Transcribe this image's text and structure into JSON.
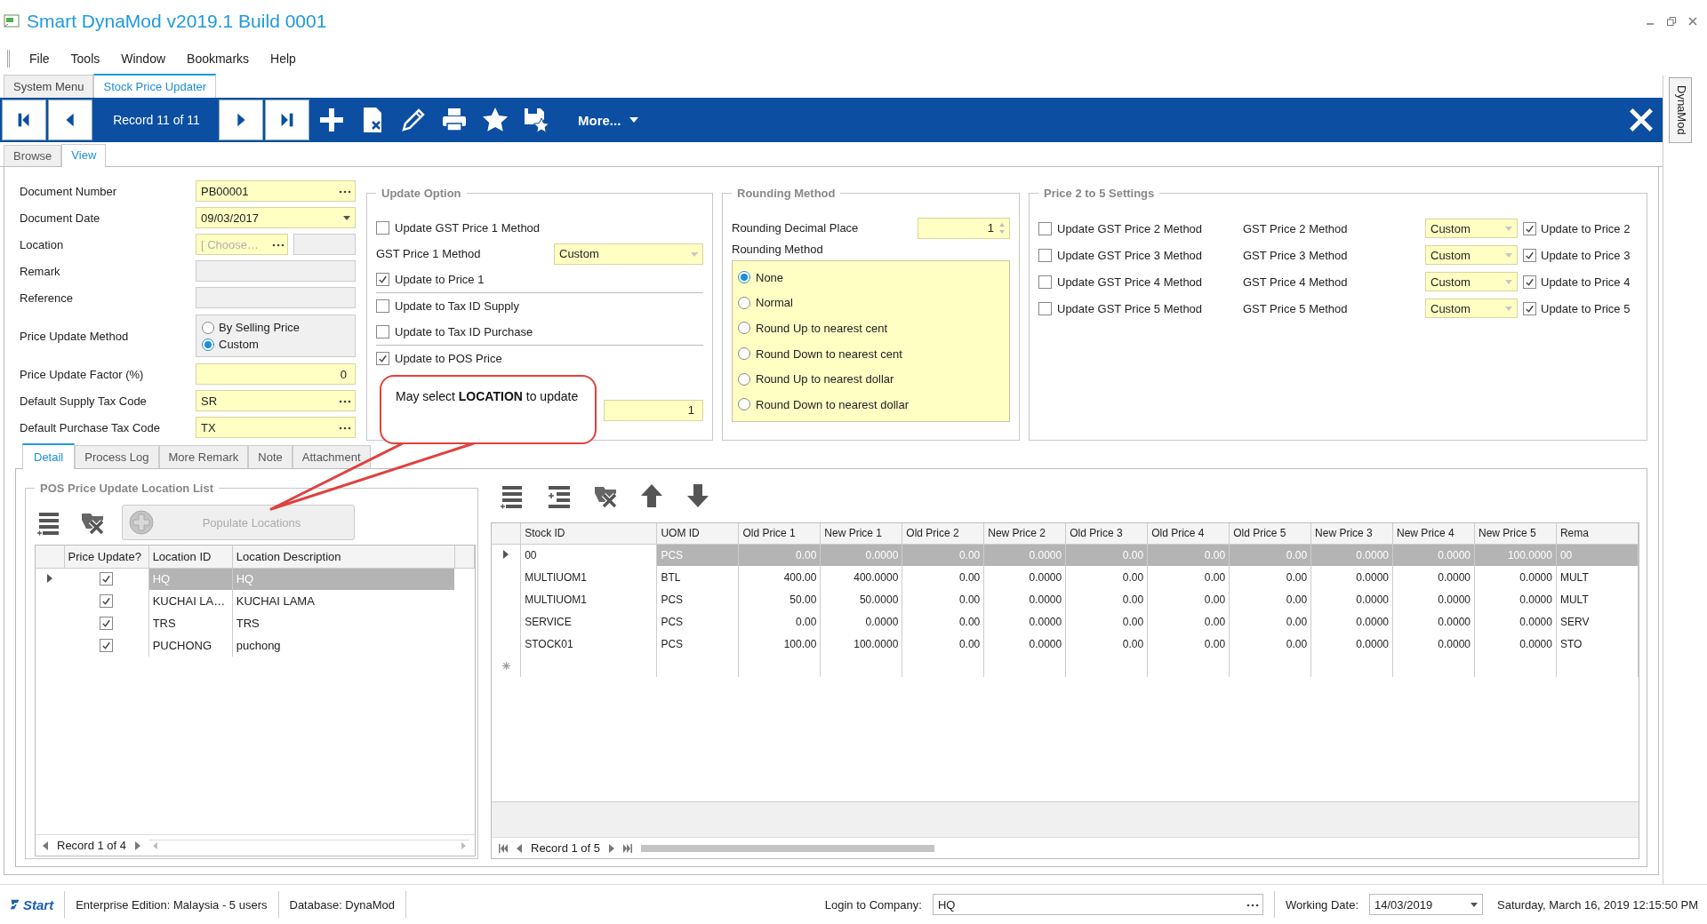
{
  "window": {
    "title": "Smart DynaMod v2019.1 Build 0001"
  },
  "menu": [
    {
      "label": "File"
    },
    {
      "label": "Tools"
    },
    {
      "label": "Window"
    },
    {
      "label": "Bookmarks"
    },
    {
      "label": "Help"
    }
  ],
  "doc_tabs": [
    {
      "label": "System Menu",
      "selected": false
    },
    {
      "label": "Stock Price Updater",
      "selected": true
    }
  ],
  "side_tab": {
    "label": "DynaMod"
  },
  "toolbar": {
    "record": "Record 11 of 11",
    "more": "More..."
  },
  "view_tabs": [
    {
      "label": "Browse",
      "selected": false
    },
    {
      "label": "View",
      "selected": true
    }
  ],
  "header_fields": [
    {
      "label": "Document Number",
      "kind": "lookup",
      "value": "PB00001"
    },
    {
      "label": "Document Date",
      "kind": "date",
      "value": "09/03/2017"
    },
    {
      "label": "Location",
      "kind": "location",
      "placeholder": "[ Choose…"
    },
    {
      "label": "Remark",
      "kind": "text",
      "disabled": true
    },
    {
      "label": "Reference",
      "kind": "text",
      "disabled": true
    },
    {
      "label": "Price Update Method",
      "kind": "radio",
      "options": [
        {
          "label": "By Selling Price",
          "selected": false
        },
        {
          "label": "Custom",
          "selected": true
        }
      ]
    },
    {
      "label": "Price Update Factor (%)",
      "kind": "number",
      "value": "0"
    },
    {
      "label": "Default Supply Tax Code",
      "kind": "lookup",
      "value": "SR"
    },
    {
      "label": "Default Purchase Tax Code",
      "kind": "lookup",
      "value": "TX"
    }
  ],
  "update_option": {
    "title": "Update Option",
    "items": [
      {
        "kind": "checkbox",
        "label": "Update GST Price 1 Method",
        "checked": false
      },
      {
        "kind": "combo",
        "label": "GST Price 1 Method",
        "value": "Custom"
      },
      {
        "kind": "checkbox",
        "label": "Update to Price 1",
        "checked": true
      },
      {
        "kind": "separator"
      },
      {
        "kind": "checkbox",
        "label": "Update to Tax ID Supply",
        "checked": false
      },
      {
        "kind": "checkbox",
        "label": "Update to Tax ID Purchase",
        "checked": false
      },
      {
        "kind": "separator"
      },
      {
        "kind": "checkbox",
        "label": "Update to POS Price",
        "checked": true
      },
      {
        "kind": "number",
        "value": "1"
      }
    ]
  },
  "rounding": {
    "title": "Rounding Method",
    "decimal_label": "Rounding Decimal Place",
    "decimal": "1",
    "method_label": "Rounding Method",
    "options": [
      {
        "label": "None",
        "selected": true
      },
      {
        "label": "Normal",
        "selected": false
      },
      {
        "label": "Round Up to nearest cent",
        "selected": false
      },
      {
        "label": "Round Down to nearest cent",
        "selected": false
      },
      {
        "label": "Round Up to nearest dollar",
        "selected": false
      },
      {
        "label": "Round Down to nearest dollar",
        "selected": false
      }
    ]
  },
  "price_settings": {
    "title": "Price 2 to 5 Settings",
    "rows": [
      {
        "check_label": "Update GST Price 2 Method",
        "checked": false,
        "method_label": "GST Price 2 Method",
        "method": "Custom",
        "update_label": "Update to Price 2",
        "update": true
      },
      {
        "check_label": "Update GST Price 3 Method",
        "checked": false,
        "method_label": "GST Price 3 Method",
        "method": "Custom",
        "update_label": "Update to Price 3",
        "update": true
      },
      {
        "check_label": "Update GST Price 4 Method",
        "checked": false,
        "method_label": "GST Price 4 Method",
        "method": "Custom",
        "update_label": "Update to Price 4",
        "update": true
      },
      {
        "check_label": "Update GST Price 5 Method",
        "checked": false,
        "method_label": "GST Price 5 Method",
        "method": "Custom",
        "update_label": "Update to Price 5",
        "update": true
      }
    ]
  },
  "detail_tabs": [
    {
      "label": "Detail",
      "selected": true
    },
    {
      "label": "Process Log",
      "selected": false
    },
    {
      "label": "More Remark",
      "selected": false
    },
    {
      "label": "Note",
      "selected": false
    },
    {
      "label": "Attachment",
      "selected": false
    }
  ],
  "location_list": {
    "title": "POS Price Update Location List",
    "populate": {
      "label": "Populate Locations",
      "disabled": true
    },
    "columns": [
      "Price Update?",
      "Location ID",
      "Location Description"
    ],
    "rows": [
      {
        "selected": true,
        "update": true,
        "location_id": "HQ",
        "description": "HQ"
      },
      {
        "selected": false,
        "update": true,
        "location_id": "KUCHAI LA…",
        "description": "KUCHAI LAMA"
      },
      {
        "selected": false,
        "update": true,
        "location_id": "TRS",
        "description": "TRS"
      },
      {
        "selected": false,
        "update": true,
        "location_id": "PUCHONG",
        "description": "puchong"
      }
    ],
    "record": "Record 1 of 4"
  },
  "stock_grid": {
    "columns": [
      {
        "label": "Stock ID",
        "kind": "text"
      },
      {
        "label": "UOM ID",
        "kind": "text"
      },
      {
        "label": "Old Price 1",
        "kind": "number"
      },
      {
        "label": "New Price 1",
        "kind": "number"
      },
      {
        "label": "Old Price 2",
        "kind": "number"
      },
      {
        "label": "New Price 2",
        "kind": "number"
      },
      {
        "label": "Old Price 3",
        "kind": "number"
      },
      {
        "label": "Old Price 4",
        "kind": "number"
      },
      {
        "label": "Old Price 5",
        "kind": "number"
      },
      {
        "label": "New Price 3",
        "kind": "number"
      },
      {
        "label": "New Price 4",
        "kind": "number"
      },
      {
        "label": "New Price 5",
        "kind": "number"
      },
      {
        "label": "Rema",
        "kind": "text"
      }
    ],
    "rows": [
      {
        "selected": true,
        "cells": [
          "00",
          "PCS",
          "0.00",
          "0.0000",
          "0.00",
          "0.0000",
          "0.00",
          "0.00",
          "0.00",
          "0.0000",
          "0.0000",
          "100.0000",
          "00"
        ]
      },
      {
        "selected": false,
        "cells": [
          "MULTIUOM1",
          "BTL",
          "400.00",
          "400.0000",
          "0.00",
          "0.0000",
          "0.00",
          "0.00",
          "0.00",
          "0.0000",
          "0.0000",
          "0.0000",
          "MULT"
        ]
      },
      {
        "selected": false,
        "cells": [
          "MULTIUOM1",
          "PCS",
          "50.00",
          "50.0000",
          "0.00",
          "0.0000",
          "0.00",
          "0.00",
          "0.00",
          "0.0000",
          "0.0000",
          "0.0000",
          "MULT"
        ]
      },
      {
        "selected": false,
        "cells": [
          "SERVICE",
          "PCS",
          "0.00",
          "0.0000",
          "0.00",
          "0.0000",
          "0.00",
          "0.00",
          "0.00",
          "0.0000",
          "0.0000",
          "0.0000",
          "SERV"
        ]
      },
      {
        "selected": false,
        "cells": [
          "STOCK01",
          "PCS",
          "100.00",
          "100.0000",
          "0.00",
          "0.0000",
          "0.00",
          "0.00",
          "0.00",
          "0.0000",
          "0.0000",
          "0.0000",
          "STO"
        ]
      }
    ],
    "record": "Record 1 of 5"
  },
  "callout": {
    "text": "May select **LOCATION** to update"
  },
  "status_bar": {
    "start": "Start",
    "edition": "Enterprise Edition: Malaysia - 5 users",
    "database": "Database: DynaMod",
    "login_label": "Login to Company:",
    "company": "HQ",
    "working_label": "Working Date:",
    "working_date": "14/03/2019",
    "datetime": "Saturday, March 16, 2019 12:15:50 PM"
  }
}
